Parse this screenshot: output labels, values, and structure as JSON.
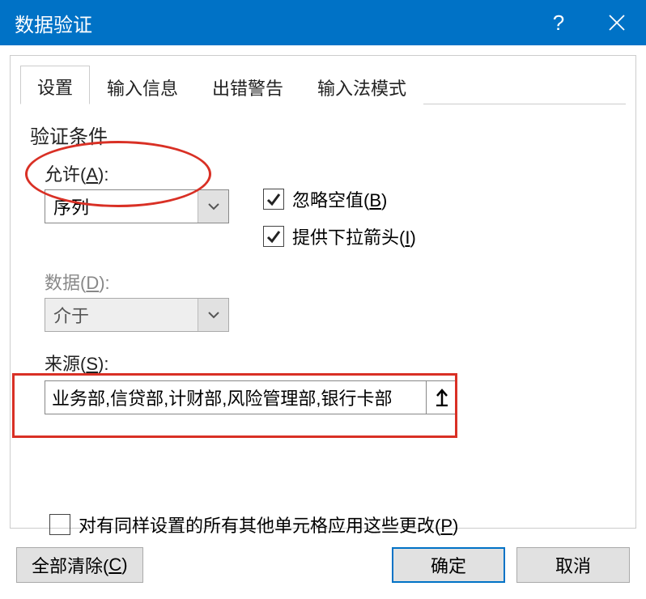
{
  "titlebar": {
    "title": "数据验证"
  },
  "tabs": {
    "settings": "设置",
    "input_message": "输入信息",
    "error_alert": "出错警告",
    "ime_mode": "输入法模式"
  },
  "section": {
    "criteria_label": "验证条件"
  },
  "fields": {
    "allow_label_prefix": "允许(",
    "allow_label_key": "A",
    "allow_label_suffix": "):",
    "allow_value": "序列",
    "data_label_prefix": "数据(",
    "data_label_key": "D",
    "data_label_suffix": "):",
    "data_value": "介于",
    "source_label_prefix": "来源(",
    "source_label_key": "S",
    "source_label_suffix": "):",
    "source_value": "业务部,信贷部,计财部,风险管理部,银行卡部"
  },
  "checkboxes": {
    "ignore_blank_prefix": "忽略空值(",
    "ignore_blank_key": "B",
    "ignore_blank_suffix": ")",
    "in_cell_dropdown_prefix": "提供下拉箭头(",
    "in_cell_dropdown_key": "I",
    "in_cell_dropdown_suffix": ")",
    "apply_all_prefix": "对有同样设置的所有其他单元格应用这些更改(",
    "apply_all_key": "P",
    "apply_all_suffix": ")"
  },
  "buttons": {
    "clear_all_prefix": "全部清除(",
    "clear_all_key": "C",
    "clear_all_suffix": ")",
    "ok": "确定",
    "cancel": "取消"
  }
}
